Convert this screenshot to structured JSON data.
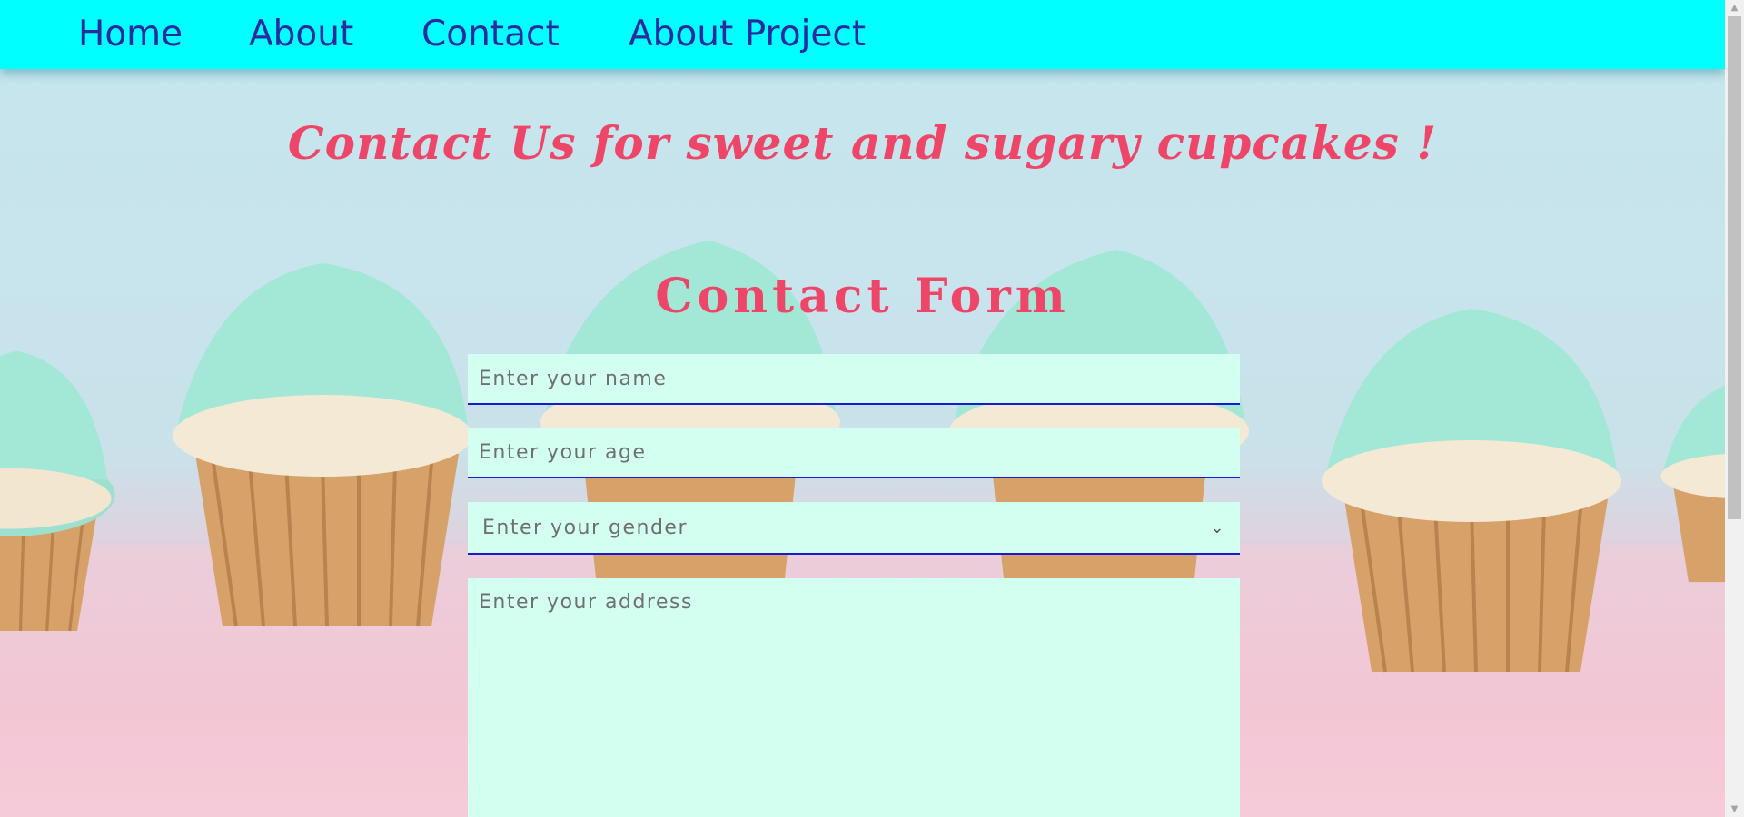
{
  "nav": {
    "items": [
      {
        "label": "Home"
      },
      {
        "label": "About"
      },
      {
        "label": "Contact"
      },
      {
        "label": "About Project"
      }
    ]
  },
  "hero": {
    "tagline": "Contact Us for sweet and sugary cupcakes !"
  },
  "form": {
    "title": "Contact Form",
    "name_placeholder": "Enter your name",
    "age_placeholder": "Enter your age",
    "gender_selected": "Enter your gender",
    "address_placeholder": "Enter your address"
  },
  "colors": {
    "nav_bg": "#00ffff",
    "nav_text": "#2b2aa0",
    "heading": "#ee4668",
    "field_bg": "#d3fff0",
    "field_underline": "#1a1ad6"
  },
  "icons": {
    "select_arrow": "chevron-down-icon",
    "scroll_up": "scroll-up-arrow-icon",
    "scroll_down": "scroll-down-arrow-icon"
  }
}
